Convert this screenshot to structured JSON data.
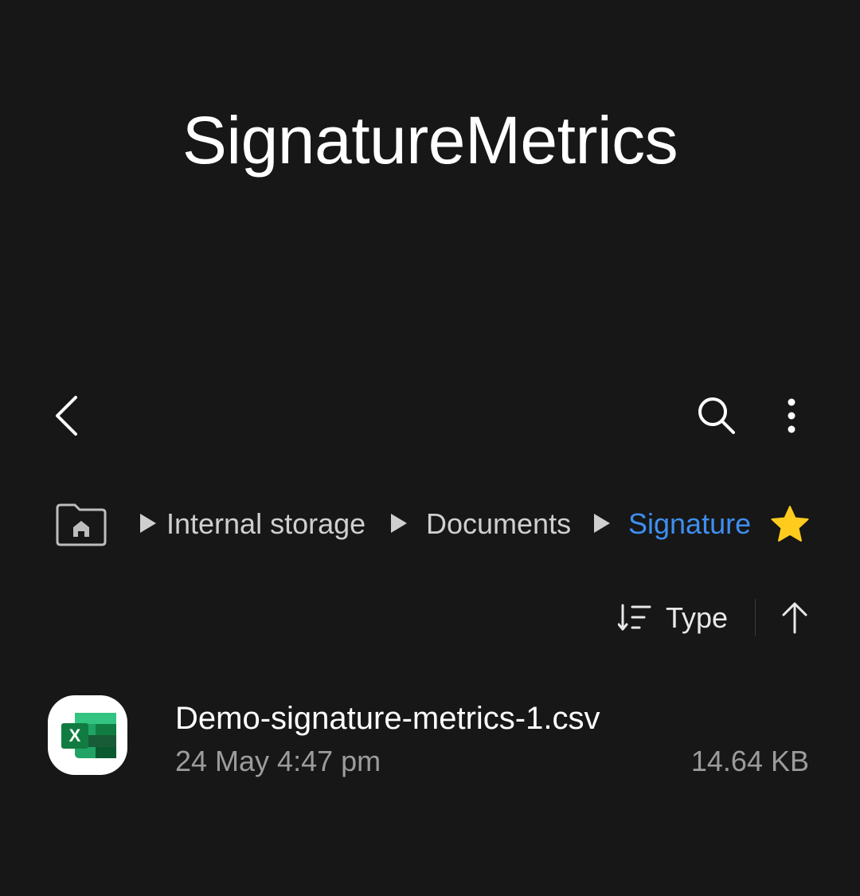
{
  "header": {
    "title": "SignatureMetrics"
  },
  "toolbar": {
    "back_icon": "chevron-left-icon",
    "search_icon": "search-icon",
    "more_icon": "more-vertical-icon"
  },
  "breadcrumb": {
    "home_icon": "home-folder-icon",
    "items": [
      {
        "label": "Internal storage"
      },
      {
        "label": "Documents"
      },
      {
        "label": "Signature"
      }
    ],
    "favorite_icon": "star-icon",
    "current_color": "#3e8ef0",
    "favorite_color": "#ffcc1e"
  },
  "sort": {
    "label": "Type",
    "icon": "sort-icon",
    "direction_icon": "arrow-up-icon"
  },
  "files": [
    {
      "name": "Demo-signature-metrics-1.csv",
      "date": "24 May 4:47 pm",
      "size": "14.64 KB",
      "icon": "excel-file-icon"
    }
  ],
  "colors": {
    "background": "#171717",
    "text_primary": "#ffffff",
    "text_secondary": "#9c9c9c",
    "excel_green": "#21a366"
  }
}
